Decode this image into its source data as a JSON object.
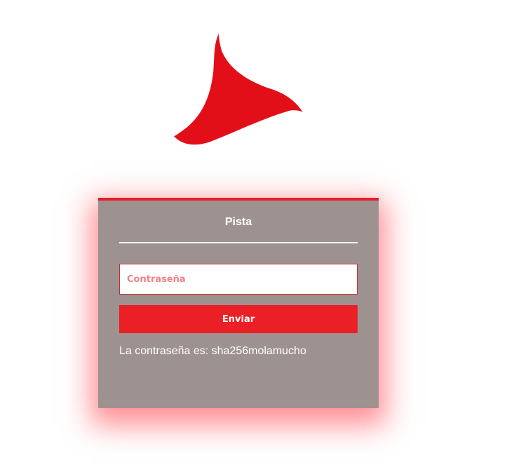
{
  "colors": {
    "accent": "#e4202a",
    "card_background": "#9e9291",
    "button": "#ea2026",
    "placeholder": "#f08389"
  },
  "logo": {
    "icon": "red-fin-logo"
  },
  "card": {
    "title": "Pista",
    "password_placeholder": "Contraseña",
    "password_value": "",
    "submit_label": "Enviar",
    "hint": "La contraseña es: sha256molamucho"
  }
}
